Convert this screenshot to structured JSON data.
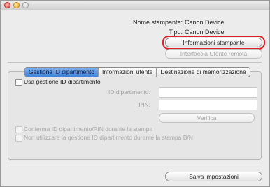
{
  "printer_info": {
    "name_label": "Nome stampante:",
    "name_value": "Canon Device",
    "type_label": "Tipo:",
    "type_value": "Canon Device"
  },
  "buttons": {
    "printer_info": "Informazioni stampante",
    "remote_ui": "Interfaccia Utente remota",
    "verify": "Verifica",
    "save_settings": "Salva impostazioni"
  },
  "tabs": [
    {
      "label": "Gestione ID dipartimento",
      "active": true
    },
    {
      "label": "Informazioni utente",
      "active": false
    },
    {
      "label": "Destinazione di memorizzazione",
      "active": false
    }
  ],
  "department": {
    "use_checkbox_label": "Usa gestione ID dipartimento",
    "id_label": "ID dipartimento:",
    "id_value": "",
    "pin_label": "PIN:",
    "pin_value": "",
    "confirm_checkbox_label": "Conferma ID dipartimento/PIN durante la stampa",
    "bw_checkbox_label": "Non utilizzare la gestione ID dipartimento durante la stampa B/N"
  },
  "colors": {
    "focus_ring": "#e01f26",
    "active_tab": "#3f82d8"
  }
}
